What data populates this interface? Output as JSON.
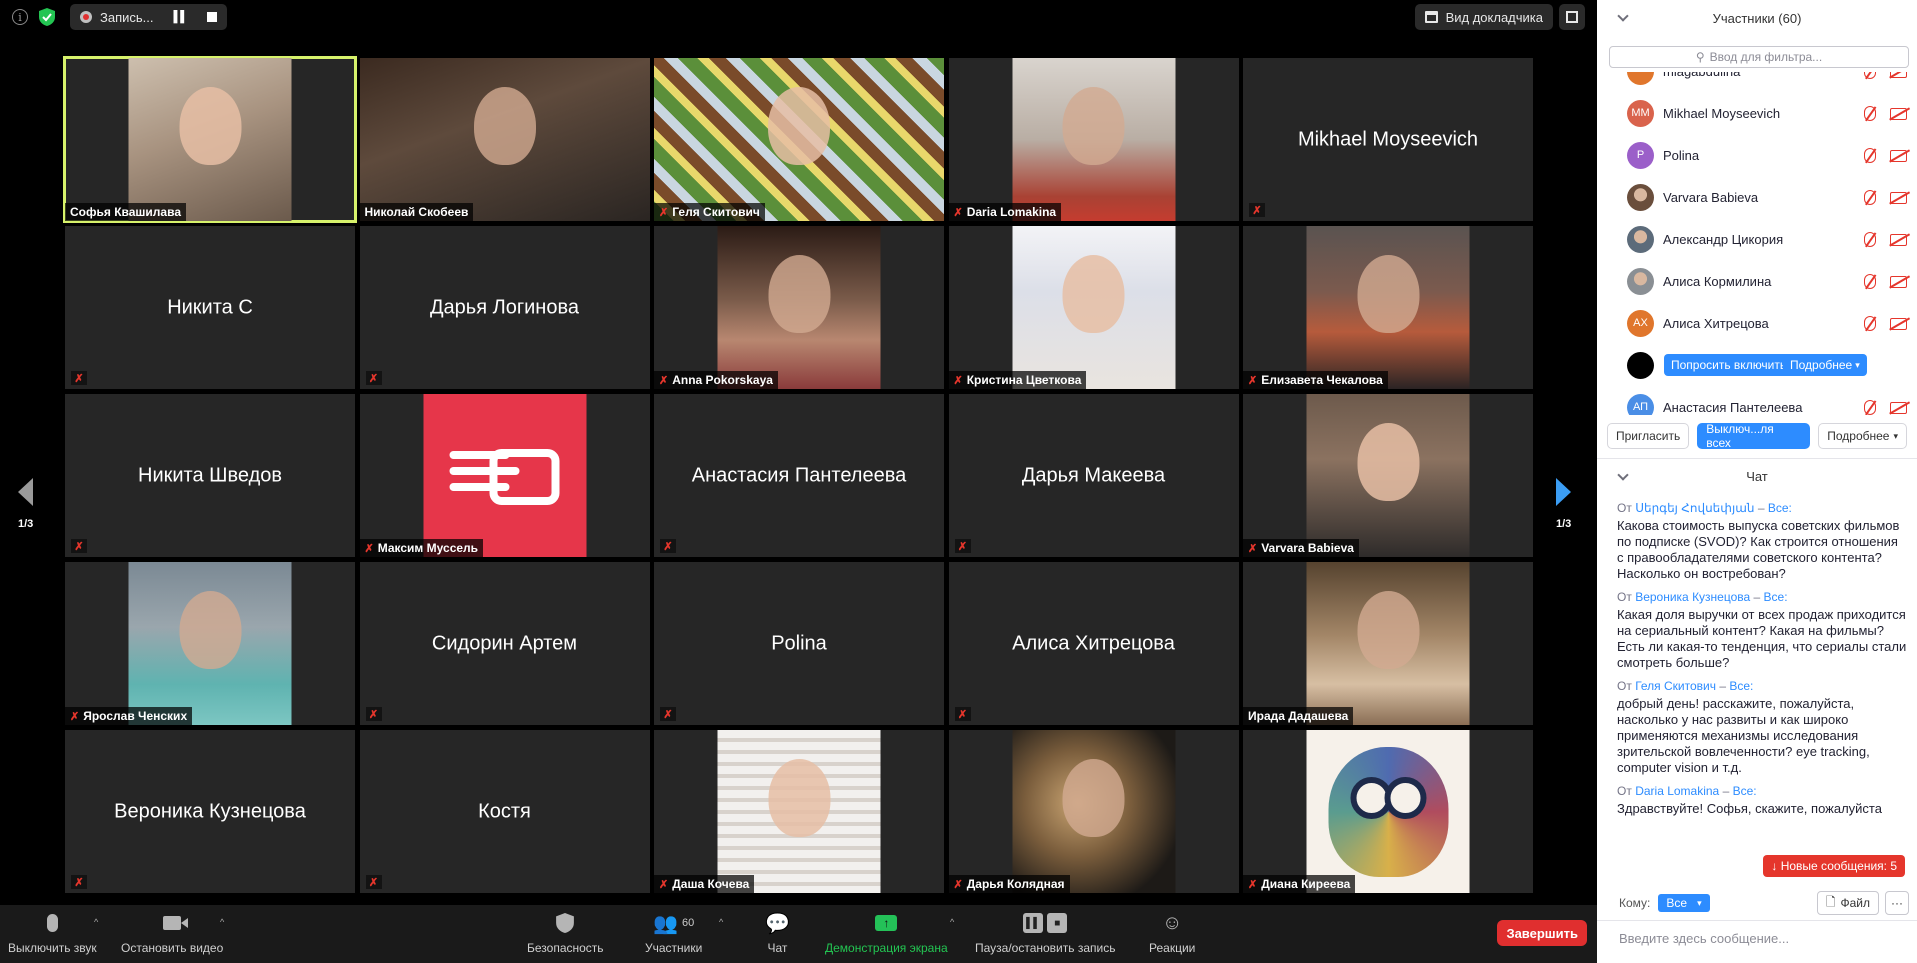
{
  "topbar": {
    "info_icon": "info-icon",
    "security_icon": "shield-check-icon",
    "recording_label": "Запись...",
    "speaker_view_label": "Вид докладчика"
  },
  "tiles": [
    {
      "name": "Софья Квашилава",
      "display": "",
      "type": "photo",
      "photo": "ph-a",
      "active": true,
      "muted": false
    },
    {
      "name": "Николай Скобеев",
      "display": "",
      "type": "photo",
      "photo": "ph-b",
      "full": true,
      "muted": false
    },
    {
      "name": "Геля Скитович",
      "display": "",
      "type": "photo",
      "photo": "ph-c",
      "full": true,
      "muted": true
    },
    {
      "name": "Daria Lomakina",
      "display": "",
      "type": "photo",
      "photo": "ph-d",
      "muted": true
    },
    {
      "name": "",
      "display": "Mikhael Moyseevich",
      "type": "name",
      "muted": true
    },
    {
      "name": "",
      "display": "Никита С",
      "type": "name",
      "muted": true
    },
    {
      "name": "",
      "display": "Дарья Логинова",
      "type": "name",
      "muted": true
    },
    {
      "name": "Anna Pokorskaya",
      "display": "",
      "type": "photo",
      "photo": "ph-e",
      "muted": true
    },
    {
      "name": "Кристина Цветкова",
      "display": "",
      "type": "photo",
      "photo": "ph-f",
      "muted": true
    },
    {
      "name": "Елизавета Чекалова",
      "display": "",
      "type": "photo",
      "photo": "ph-g",
      "muted": true
    },
    {
      "name": "",
      "display": "Никита Шведов",
      "type": "name",
      "muted": true
    },
    {
      "name": "Максим Муссель",
      "display": "",
      "type": "logo",
      "photo": "ph-h",
      "muted": true
    },
    {
      "name": "",
      "display": "Анастасия Пантелеева",
      "type": "name",
      "muted": true
    },
    {
      "name": "",
      "display": "Дарья Макеева",
      "type": "name",
      "muted": true
    },
    {
      "name": "Varvara Babieva",
      "display": "",
      "type": "photo",
      "photo": "ph-i",
      "muted": true
    },
    {
      "name": "Ярослав Ченских",
      "display": "",
      "type": "photo",
      "photo": "ph-j",
      "muted": true
    },
    {
      "name": "",
      "display": "Сидорин Артем",
      "type": "name",
      "muted": true
    },
    {
      "name": "",
      "display": "Polina",
      "type": "name",
      "muted": true
    },
    {
      "name": "",
      "display": "Алиса Хитрецова",
      "type": "name",
      "muted": true
    },
    {
      "name": "Ирада Дадашева",
      "display": "",
      "type": "photo",
      "photo": "ph-k",
      "muted": false
    },
    {
      "name": "",
      "display": "Вероника Кузнецова",
      "type": "name",
      "muted": true
    },
    {
      "name": "",
      "display": "Костя",
      "type": "name",
      "muted": true
    },
    {
      "name": "Даша Кочева",
      "display": "",
      "type": "photo",
      "photo": "ph-l",
      "muted": true
    },
    {
      "name": "Дарья Колядная",
      "display": "",
      "type": "photo",
      "photo": "ph-m",
      "muted": true
    },
    {
      "name": "Диана Киреева",
      "display": "",
      "type": "owl",
      "photo": "ph-n",
      "muted": true
    }
  ],
  "paging": {
    "left": "1/3",
    "right": "1/3"
  },
  "toolbar": {
    "mute": "Выключить звук",
    "stop_video": "Остановить видео",
    "security": "Безопасность",
    "participants": "Участники",
    "participants_count": "60",
    "chat": "Чат",
    "share": "Демонстрация экрана",
    "pause_record": "Пауза/остановить запись",
    "reactions": "Реакции",
    "end": "Завершить"
  },
  "participants_panel": {
    "title": "Участники (60)",
    "filter_placeholder": "Ввод для фильтра...",
    "rows": [
      {
        "name": "mlagabdulina",
        "initials": "",
        "color": "#e0762c",
        "type": "initials"
      },
      {
        "name": "Mikhael Moyseevich",
        "initials": "MM",
        "color": "#d9634c",
        "type": "initials"
      },
      {
        "name": "Polina",
        "initials": "P",
        "color": "#9b5fc9",
        "type": "initials"
      },
      {
        "name": "Varvara Babieva",
        "initials": "",
        "color": "#6a4e3c",
        "type": "photo"
      },
      {
        "name": "Александр Цикория",
        "initials": "",
        "color": "#5c6b7a",
        "type": "photo"
      },
      {
        "name": "Алиса Кормилина",
        "initials": "",
        "color": "#8a8f94",
        "type": "photo"
      },
      {
        "name": "Алиса Хитрецова",
        "initials": "АХ",
        "color": "#e0762c",
        "type": "initials"
      },
      {
        "name": "",
        "initials": "",
        "color": "#000000",
        "type": "hover"
      },
      {
        "name": "Анастасия Пантелеева",
        "initials": "АП",
        "color": "#4a8ee6",
        "type": "initials"
      }
    ],
    "ask_unmute": "Попросить включить",
    "more": "Подробнее",
    "invite": "Пригласить",
    "mute_all": "Выключ...ля всех",
    "more_actions": "Подробнее"
  },
  "chat_panel": {
    "title": "Чат",
    "from_prefix": "От",
    "to_all": "Все:",
    "messages": [
      {
        "from": "Սերգեյ Հովսեփյան",
        "text": "Какова стоимость выпуска советских фильмов по подписке (SVOD)? Как строится отношения с правообладателями советского контента? Насколько он востребован?"
      },
      {
        "from": "Вероника Кузнецова",
        "text": "Какая доля выручки от всех продаж приходится на сериальный контент? Какая на фильмы? Есть ли какая-то тенденция, что сериалы стали смотреть больше?"
      },
      {
        "from": "Геля Скитович",
        "text": "добрый день! расскажите, пожалуйста, насколько у нас развиты и как широко применяются механизмы исследования зрительской вовлеченности? eye tracking, computer vision  и т.д."
      },
      {
        "from": "Daria Lomakina",
        "text": "Здравствуйте! Софья, скажите, пожалуйста"
      }
    ],
    "new_messages": "↓ Новые сообщения: 5",
    "to_label": "Кому:",
    "to_value": "Все",
    "file": "Файл",
    "more": "···",
    "input_placeholder": "Введите здесь сообщение..."
  }
}
